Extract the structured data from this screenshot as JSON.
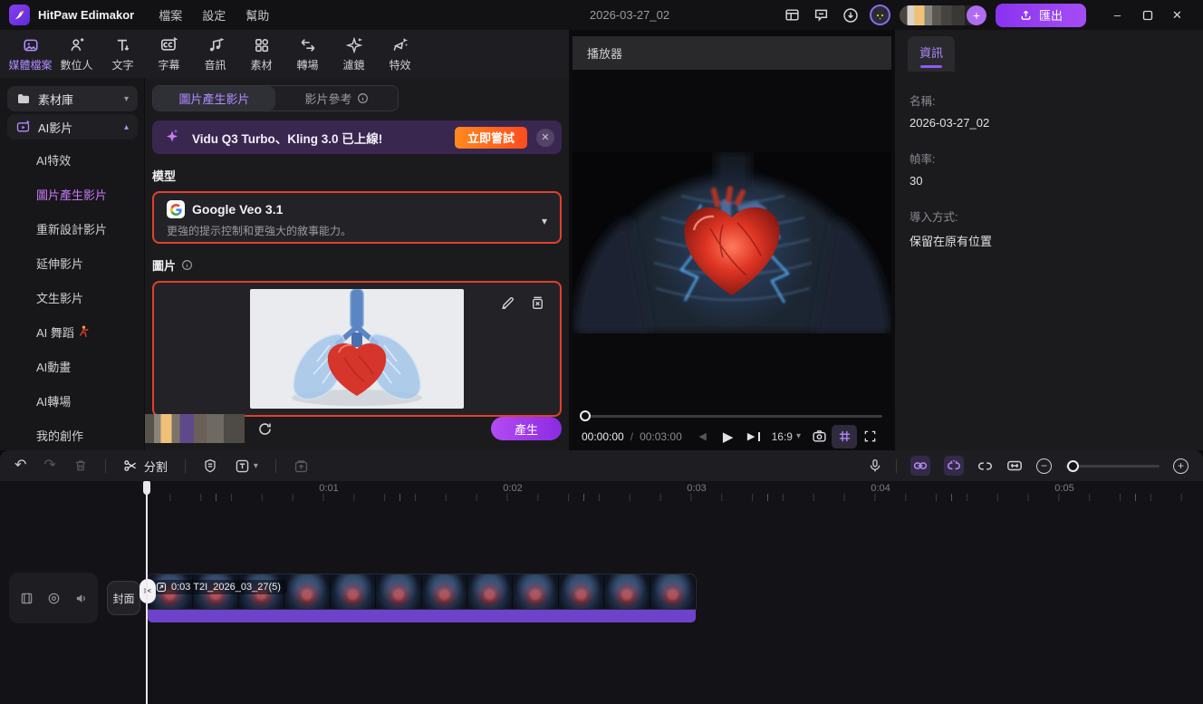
{
  "titlebar": {
    "app_name": "HitPaw Edimakor",
    "menus": [
      {
        "label": "檔案"
      },
      {
        "label": "設定"
      },
      {
        "label": "幫助"
      }
    ],
    "project_title": "2026-03-27_02",
    "export_label": "匯出"
  },
  "toolbar": {
    "items": [
      {
        "label": "媒體檔案",
        "icon": "media-icon",
        "active": true
      },
      {
        "label": "數位人",
        "icon": "digital-human-icon"
      },
      {
        "label": "文字",
        "icon": "text-icon"
      },
      {
        "label": "字幕",
        "icon": "subtitle-icon"
      },
      {
        "label": "音訊",
        "icon": "audio-icon"
      },
      {
        "label": "素材",
        "icon": "stickers-icon"
      },
      {
        "label": "轉場",
        "icon": "transition-icon"
      },
      {
        "label": "濾鏡",
        "icon": "filter-icon"
      },
      {
        "label": "特效",
        "icon": "effects-icon"
      }
    ]
  },
  "sidebar": {
    "groups": [
      {
        "label": "素材庫"
      },
      {
        "label": "AI影片"
      }
    ],
    "items": [
      {
        "label": "AI特效"
      },
      {
        "label": "圖片產生影片",
        "active": true
      },
      {
        "label": "重新設計影片"
      },
      {
        "label": "延伸影片"
      },
      {
        "label": "文生影片"
      },
      {
        "label": "AI 舞蹈",
        "emoji": "dancer-icon"
      },
      {
        "label": "AI動畫"
      },
      {
        "label": "AI轉場"
      },
      {
        "label": "我的創作"
      }
    ]
  },
  "gen": {
    "tabs": [
      {
        "label": "圖片產生影片",
        "active": true
      },
      {
        "label": "影片參考"
      }
    ],
    "banner": {
      "text": "Vidu Q3 Turbo、Kling 3.0 已上線!",
      "cta": "立即嘗試"
    },
    "model_label": "模型",
    "model_name": "Google Veo 3.1",
    "model_desc": "更強的提示控制和更強大的敘事能力。",
    "image_label": "圖片",
    "generate_label": "產生"
  },
  "player": {
    "title": "播放器",
    "time_current": "00:00:00",
    "time_separator": "/",
    "time_total": "00:03:00",
    "aspect_ratio": "16:9"
  },
  "info": {
    "tab": "資訊",
    "fields": [
      {
        "label": "名稱:",
        "value": "2026-03-27_02"
      },
      {
        "label": "幀率:",
        "value": "30"
      },
      {
        "label": "導入方式:",
        "value": "保留在原有位置"
      }
    ]
  },
  "edit_toolbar": {
    "split_label": "分割"
  },
  "timeline": {
    "ruler": [
      "0:01",
      "0:02",
      "0:03",
      "0:04",
      "0:05"
    ],
    "clip_label": "0:03 T2I_2026_03_27(5)",
    "cover_label": "封面"
  },
  "icons": {
    "undo": "↶",
    "redo": "↷",
    "scissors": "✂",
    "play": "▶",
    "prev_frame": "◀",
    "next_frame": "▶",
    "caret_down": "▾",
    "caret_up": "▴",
    "close": "✕",
    "minimize": "–",
    "plus": "+",
    "minus": "−",
    "banner_close": "✕",
    "text_tool": "T"
  },
  "colors": {
    "accent_purple": "#9b4df5",
    "active_text": "#b18cff",
    "alert_border": "#e2402c",
    "banner_cta_orange": "#ff6a1f",
    "audio_strip": "#6e43cc"
  }
}
